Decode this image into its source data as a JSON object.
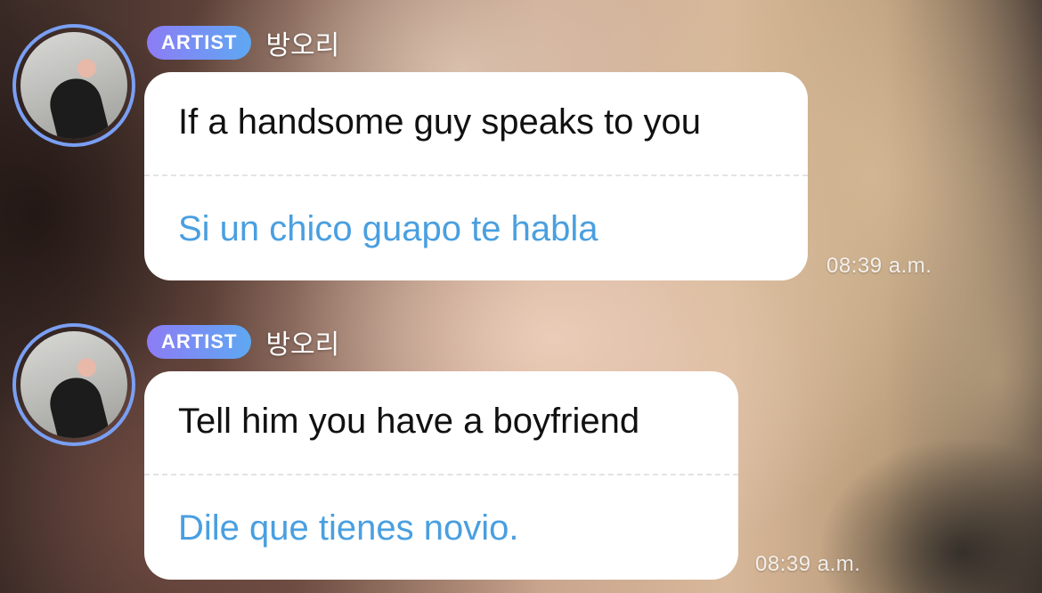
{
  "messages": [
    {
      "badge": "ARTIST",
      "sender": "방오리",
      "original": "If a handsome guy speaks to you",
      "translation": "Si un chico guapo te habla",
      "time": "08:39 a.m."
    },
    {
      "badge": "ARTIST",
      "sender": "방오리",
      "original": "Tell him you have a boyfriend",
      "translation": "Dile que tienes novio.",
      "time": "08:39 a.m."
    }
  ],
  "colors": {
    "badge_gradient_start": "#8d7cf5",
    "badge_gradient_end": "#5ea8f2",
    "avatar_ring": "#7a9ff3",
    "translation_text": "#4a9fe0",
    "bubble_bg": "#ffffff"
  }
}
